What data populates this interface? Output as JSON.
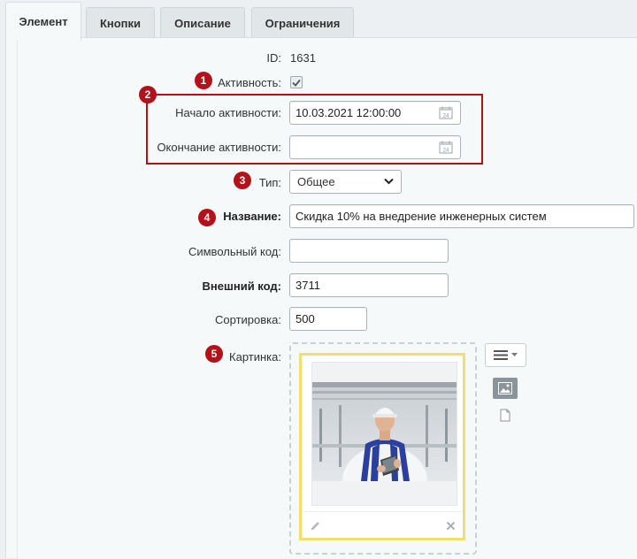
{
  "tabs": [
    {
      "label": "Элемент",
      "active": true
    },
    {
      "label": "Кнопки",
      "active": false
    },
    {
      "label": "Описание",
      "active": false
    },
    {
      "label": "Ограничения",
      "active": false
    }
  ],
  "form": {
    "id": {
      "label": "ID:",
      "value": "1631"
    },
    "active": {
      "label": "Активность:",
      "checked": true
    },
    "active_from": {
      "label": "Начало активности:",
      "value": "10.03.2021 12:00:00"
    },
    "active_to": {
      "label": "Окончание активности:",
      "value": ""
    },
    "type": {
      "label": "Тип:",
      "value": "Общее"
    },
    "name": {
      "label": "Название:",
      "value": "Скидка 10% на внедрение инженерных систем"
    },
    "code": {
      "label": "Символьный код:",
      "value": ""
    },
    "xml_id": {
      "label": "Внешний код:",
      "value": "3711"
    },
    "sort": {
      "label": "Сортировка:",
      "value": "500"
    },
    "picture": {
      "label": "Картинка:"
    }
  },
  "badges": [
    "1",
    "2",
    "3",
    "4",
    "5"
  ],
  "colors": {
    "accent_red": "#b3121a",
    "card_border": "#f2de6e",
    "panel_bg": "#f5f9f9"
  },
  "icons": {
    "calendar": "calendar-icon",
    "checkmark": "checkmark-icon",
    "chevron": "chevron-down-icon",
    "edit": "pencil-icon",
    "delete": "close-icon",
    "menu": "hamburger-menu-icon",
    "image": "image-icon",
    "file": "file-icon"
  }
}
